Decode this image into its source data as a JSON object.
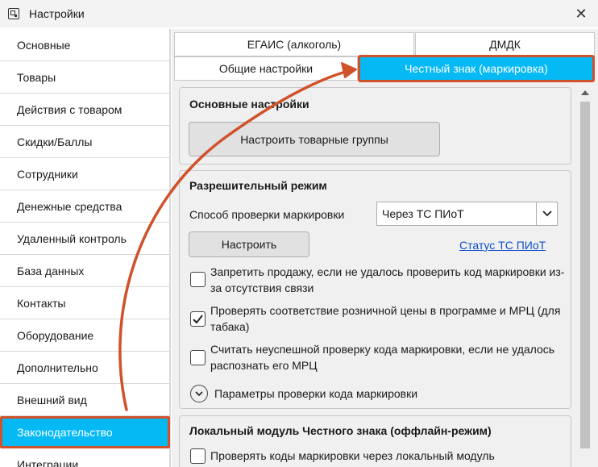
{
  "window": {
    "title": "Настройки",
    "icon": "settings-app-icon",
    "close_glyph": "✕"
  },
  "sidebar": {
    "items": [
      {
        "label": "Основные",
        "active": false
      },
      {
        "label": "Товары",
        "active": false
      },
      {
        "label": "Действия с товаром",
        "active": false
      },
      {
        "label": "Скидки/Баллы",
        "active": false
      },
      {
        "label": "Сотрудники",
        "active": false
      },
      {
        "label": "Денежные средства",
        "active": false
      },
      {
        "label": "Удаленный контроль",
        "active": false
      },
      {
        "label": "База данных",
        "active": false
      },
      {
        "label": "Контакты",
        "active": false
      },
      {
        "label": "Оборудование",
        "active": false
      },
      {
        "label": "Дополнительно",
        "active": false
      },
      {
        "label": "Внешний вид",
        "active": false
      },
      {
        "label": "Законодательство",
        "active": true
      },
      {
        "label": "Интеграции",
        "active": false
      }
    ]
  },
  "tabs": {
    "row1": [
      {
        "label": "ЕГАИС (алкоголь)"
      },
      {
        "label": "ДМДК"
      }
    ],
    "row2": [
      {
        "label": "Общие настройки",
        "active": false
      },
      {
        "label": "Честный знак (маркировка)",
        "active": true
      }
    ]
  },
  "basic": {
    "title": "Основные настройки",
    "configure_groups_label": "Настроить товарные группы"
  },
  "permissive": {
    "title": "Разрешительный режим",
    "method_label": "Способ проверки маркировки",
    "method_value": "Через ТС ПИоТ",
    "configure_label": "Настроить",
    "status_link": "Статус ТС ПИоТ",
    "checkboxes": [
      {
        "text": "Запретить продажу, если не удалось проверить код маркировки из-за отсутствия связи",
        "checked": false
      },
      {
        "text": "Проверять соответствие розничной цены в программе и МРЦ (для табака)",
        "checked": true
      },
      {
        "text": "Считать неуспешной проверку кода маркировки, если не удалось распознать его МРЦ",
        "checked": false
      }
    ],
    "expander_label": "Параметры проверки кода маркировки"
  },
  "local_module": {
    "title": "Локальный модуль Честного знака (оффлайн-режим)",
    "checkbox_text": "Проверять коды маркировки через локальный модуль",
    "checked": false
  },
  "colors": {
    "accent": "#05b9f5",
    "highlight_border": "#d0522a",
    "link": "#0b4fc9"
  }
}
